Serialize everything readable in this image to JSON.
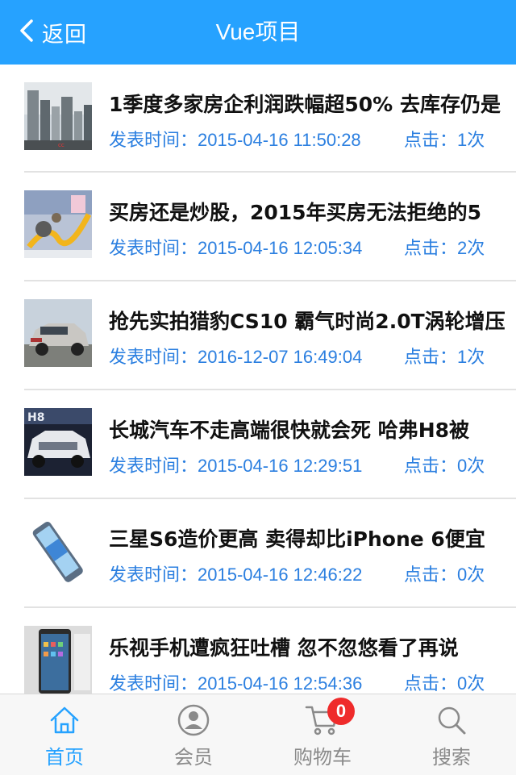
{
  "header": {
    "back_label": "返回",
    "title": "Vue项目"
  },
  "news": [
    {
      "title": "1季度多家房企利润跌幅超50% 去库存仍是",
      "time_label": "发表时间：",
      "time": "2015-04-16 11:50:28",
      "clicks_label": "点击：",
      "clicks": "1次",
      "thumb": "buildings"
    },
    {
      "title": "买房还是炒股，2015年买房无法拒绝的5",
      "time_label": "发表时间：",
      "time": "2015-04-16 12:05:34",
      "clicks_label": "点击：",
      "clicks": "2次",
      "thumb": "money-cartoon"
    },
    {
      "title": "抢先实拍猎豹CS10 霸气时尚2.0T涡轮增压",
      "time_label": "发表时间：",
      "time": "2016-12-07 16:49:04",
      "clicks_label": "点击：",
      "clicks": "1次",
      "thumb": "silver-suv"
    },
    {
      "title": "长城汽车不走高端很快就会死 哈弗H8被",
      "time_label": "发表时间：",
      "time": "2015-04-16 12:29:51",
      "clicks_label": "点击：",
      "clicks": "0次",
      "thumb": "white-suv"
    },
    {
      "title": "三星S6造价更高 卖得却比iPhone 6便宜",
      "time_label": "发表时间：",
      "time": "2015-04-16 12:46:22",
      "clicks_label": "点击：",
      "clicks": "0次",
      "thumb": "phone-edge"
    },
    {
      "title": "乐视手机遭疯狂吐槽 忽不忽悠看了再说",
      "time_label": "发表时间：",
      "time": "2015-04-16 12:54:36",
      "clicks_label": "点击：",
      "clicks": "0次",
      "thumb": "phone-front"
    }
  ],
  "tabbar": {
    "home_label": "首页",
    "member_label": "会员",
    "cart_label": "购物车",
    "cart_count": "0",
    "search_label": "搜索"
  },
  "colors": {
    "accent": "#26a2ff",
    "meta_text": "#2b7fe0",
    "badge": "#ef2b2b"
  }
}
